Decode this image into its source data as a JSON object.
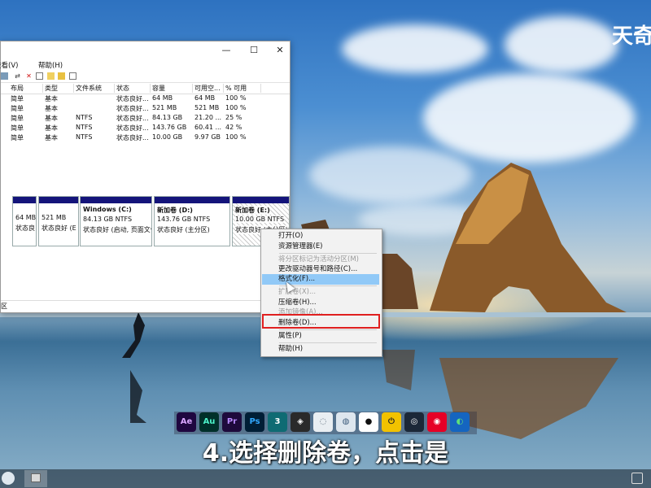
{
  "brand": "天奇",
  "caption": "4.选择删除卷，点击是",
  "window": {
    "controls": {
      "minimize": "—",
      "maximize": "☐",
      "close": "✕"
    },
    "menu": [
      "查看(V)",
      "帮助(H)"
    ],
    "menu_partial_prefix": "查看",
    "columns": [
      "布局",
      "类型",
      "文件系统",
      "状态",
      "容量",
      "可用空...",
      "% 可用"
    ],
    "rows": [
      [
        "简单",
        "基本",
        "",
        "状态良好...",
        "64 MB",
        "64 MB",
        "100 %"
      ],
      [
        "简单",
        "基本",
        "",
        "状态良好...",
        "521 MB",
        "521 MB",
        "100 %"
      ],
      [
        "简单",
        "基本",
        "NTFS",
        "状态良好...",
        "84.13 GB",
        "21.20 ...",
        "25 %"
      ],
      [
        "简单",
        "基本",
        "NTFS",
        "状态良好...",
        "143.76 GB",
        "60.41 ...",
        "42 %"
      ],
      [
        "简单",
        "基本",
        "NTFS",
        "状态良好...",
        "10.00 GB",
        "9.97 GB",
        "100 %"
      ]
    ],
    "partitions": [
      {
        "name": "",
        "size": "64 MB",
        "status": "状态良"
      },
      {
        "name": "",
        "size": "521 MB",
        "status": "状态良好 (E"
      },
      {
        "name": "Windows  (C:)",
        "size": "84.13 GB NTFS",
        "status": "状态良好 (启动, 页面文件"
      },
      {
        "name": "新加卷  (D:)",
        "size": "143.76 GB NTFS",
        "status": "状态良好 (主分区)"
      },
      {
        "name": "新加卷  (E:)",
        "size": "10.00 GB NTFS",
        "status": "状态良好 (主分区)"
      }
    ],
    "footer_text": "区"
  },
  "context_menu": {
    "items": [
      {
        "label": "打开(O)",
        "enabled": true
      },
      {
        "label": "资源管理器(E)",
        "enabled": true
      },
      {
        "label": "将分区标记为活动分区(M)",
        "enabled": false
      },
      {
        "label": "更改驱动器号和路径(C)...",
        "enabled": true
      },
      {
        "label": "格式化(F)...",
        "enabled": true,
        "highlighted": true
      },
      {
        "label": "扩展卷(X)...",
        "enabled": false
      },
      {
        "label": "压缩卷(H)...",
        "enabled": true
      },
      {
        "label": "添加镜像(A)...",
        "enabled": false
      },
      {
        "label": "删除卷(D)...",
        "enabled": true,
        "outlined": true
      },
      {
        "label": "属性(P)",
        "enabled": true
      },
      {
        "label": "帮助(H)",
        "enabled": true
      }
    ]
  },
  "dock_apps": [
    {
      "name": "after-effects-icon",
      "text": "Ae",
      "bg": "#1f0740",
      "fg": "#d9a7ff"
    },
    {
      "name": "audition-icon",
      "text": "Au",
      "bg": "#00302a",
      "fg": "#4cf2c9"
    },
    {
      "name": "premiere-icon",
      "text": "Pr",
      "bg": "#1e0a3c",
      "fg": "#b98aff"
    },
    {
      "name": "photoshop-icon",
      "text": "Ps",
      "bg": "#001e36",
      "fg": "#31a8ff"
    },
    {
      "name": "3dsmax-icon",
      "text": "3",
      "bg": "#0f6b73",
      "fg": "#ffffff"
    },
    {
      "name": "unity-icon",
      "text": "◈",
      "bg": "#2a2a2a",
      "fg": "#ffffff"
    },
    {
      "name": "drop-icon",
      "text": "◌",
      "bg": "#e9eef2",
      "fg": "#5a6a78"
    },
    {
      "name": "globe-icon",
      "text": "◍",
      "bg": "#dde6ee",
      "fg": "#3a5a7a"
    },
    {
      "name": "qq-icon",
      "text": "●",
      "bg": "#ffffff",
      "fg": "#111111"
    },
    {
      "name": "power-icon",
      "text": "⏻",
      "bg": "#f2c200",
      "fg": "#222222"
    },
    {
      "name": "steam-icon",
      "text": "◎",
      "bg": "#1b2838",
      "fg": "#ffffff"
    },
    {
      "name": "netease-music-icon",
      "text": "◉",
      "bg": "#e60026",
      "fg": "#ffffff"
    },
    {
      "name": "edge-icon",
      "text": "◐",
      "bg": "#1565c0",
      "fg": "#5ee07a"
    }
  ]
}
